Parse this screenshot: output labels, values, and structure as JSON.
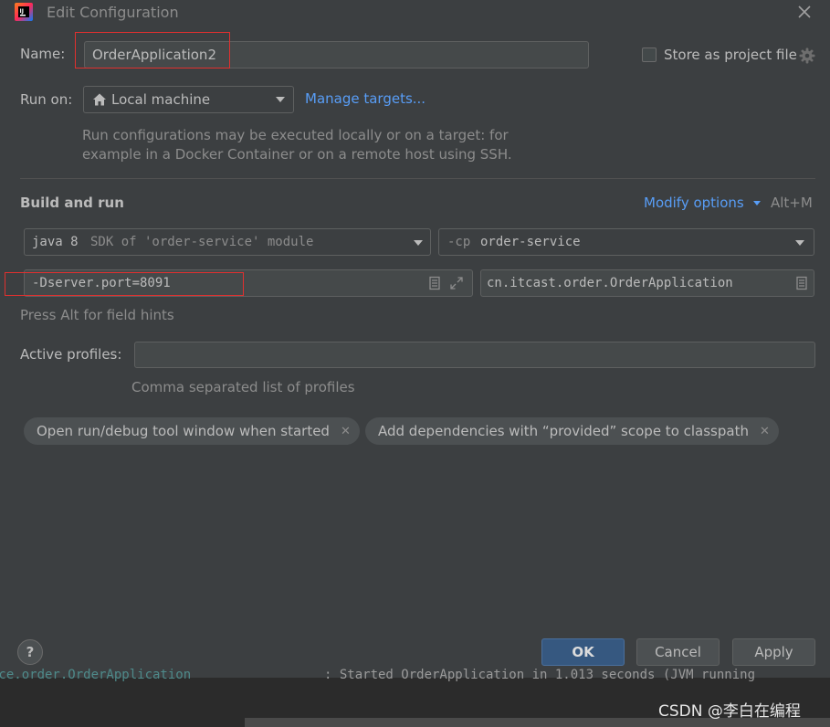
{
  "window": {
    "title": "Edit Configuration"
  },
  "name_row": {
    "label": "Name:",
    "value": "OrderApplication2",
    "store_label": "Store as project file"
  },
  "run_on": {
    "label": "Run on:",
    "value": "Local machine",
    "manage_link": "Manage targets...",
    "hint_line1": "Run configurations may be executed locally or on a target: for",
    "hint_line2": "example in a Docker Container or on a remote host using SSH."
  },
  "build": {
    "heading": "Build and run",
    "modify_options": "Modify options",
    "shortcut": "Alt+M",
    "jdk_main": "java 8",
    "jdk_detail": "SDK of 'order-service' module",
    "cp_prefix": "-cp",
    "cp_value": "order-service",
    "vm_options": "-Dserver.port=8091",
    "main_class": "cn.itcast.order.OrderApplication",
    "field_hint": "Press Alt for field hints"
  },
  "profiles": {
    "label": "Active profiles:",
    "value": "",
    "hint": "Comma separated list of profiles"
  },
  "chips": [
    {
      "label": "Open run/debug tool window when started"
    },
    {
      "label": "Add dependencies with “provided” scope to classpath"
    }
  ],
  "buttons": {
    "help": "?",
    "ok": "OK",
    "cancel": "Cancel",
    "apply": "Apply"
  },
  "background": {
    "console_left": "ace.order.OrderApplication",
    "console_right": ": Started OrderApplication in 1.013 seconds (JVM running",
    "watermark": "CSDN @李白在编程"
  },
  "colors": {
    "dialog_bg": "#3c3f41",
    "field_bg": "#45494a",
    "link": "#589df6",
    "ok_bg": "#365880",
    "highlight_box": "#e0302f"
  }
}
